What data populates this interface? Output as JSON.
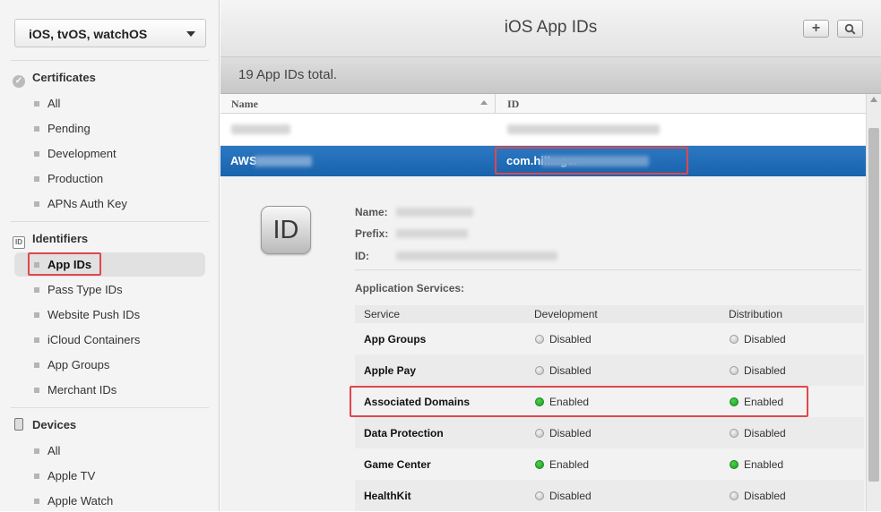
{
  "sidebar": {
    "platform_select": "iOS, tvOS, watchOS",
    "sections": {
      "certificates": {
        "title": "Certificates",
        "items": [
          "All",
          "Pending",
          "Development",
          "Production",
          "APNs Auth Key"
        ]
      },
      "identifiers": {
        "title": "Identifiers",
        "items": [
          "App IDs",
          "Pass Type IDs",
          "Website Push IDs",
          "iCloud Containers",
          "App Groups",
          "Merchant IDs"
        ],
        "active": "App IDs"
      },
      "devices": {
        "title": "Devices",
        "items": [
          "All",
          "Apple TV",
          "Apple Watch"
        ]
      }
    }
  },
  "header": {
    "title": "iOS App IDs",
    "add_icon": "plus-icon",
    "search_icon": "search-icon"
  },
  "summary": {
    "count_text": "19  App IDs total."
  },
  "table": {
    "columns": [
      "Name",
      "ID"
    ],
    "rows": [
      {
        "name": "",
        "id": "",
        "selected": false
      },
      {
        "name": "AWS",
        "id": "com.hill...ger",
        "selected": true
      }
    ]
  },
  "detail": {
    "icon_text": "ID",
    "labels": {
      "name": "Name:",
      "prefix": "Prefix:",
      "id": "ID:"
    },
    "services_label": "Application Services:",
    "service_headers": [
      "Service",
      "Development",
      "Distribution"
    ],
    "services": [
      {
        "name": "App Groups",
        "development": "Disabled",
        "distribution": "Disabled"
      },
      {
        "name": "Apple Pay",
        "development": "Disabled",
        "distribution": "Disabled"
      },
      {
        "name": "Associated Domains",
        "development": "Enabled",
        "distribution": "Enabled"
      },
      {
        "name": "Data Protection",
        "development": "Disabled",
        "distribution": "Disabled"
      },
      {
        "name": "Game Center",
        "development": "Enabled",
        "distribution": "Enabled"
      },
      {
        "name": "HealthKit",
        "development": "Disabled",
        "distribution": "Disabled"
      }
    ]
  },
  "colors": {
    "selection_blue": "#1f6db6",
    "highlight_red": "#e0474c",
    "enabled_green": "#22a82a"
  }
}
